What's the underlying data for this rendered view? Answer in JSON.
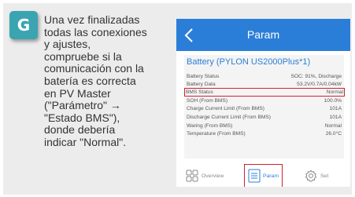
{
  "step": {
    "label": "G",
    "color": "#3aa4b1"
  },
  "instruction": "Una vez finalizadas\ntodas las conexiones\ny ajustes,\ncompruebe si la\ncomunicación con la\nbatería es correcta\nen PV Master\n(\"Parámetro\" →\n\"Estado BMS\"),\ndonde debería\nindicar \"Normal\".",
  "app": {
    "title": "Param",
    "header_color": "#2b7ed8",
    "panel_title": "Battery (PYLON US2000Plus*1)",
    "rows": [
      {
        "label": "Battery Status",
        "value": "SOC: 91%, Discharge"
      },
      {
        "label": "Battery Data",
        "value": "53.2V/0.7A/0.04kW"
      },
      {
        "label": "BMS Status",
        "value": "Normal"
      },
      {
        "label": "SOH (From BMS)",
        "value": "100.0%"
      },
      {
        "label": "Charge Current Limit (From BMS)",
        "value": "101A"
      },
      {
        "label": "Discharge Current Limit (From BMS)",
        "value": "101A"
      },
      {
        "label": "Waring (From BMS)",
        "value": "Normal"
      },
      {
        "label": "Temperature (From BMS)",
        "value": "26.0°C"
      }
    ],
    "highlight_color": "#d4202c",
    "tabs": [
      {
        "label": "Overview",
        "icon": "overview-icon"
      },
      {
        "label": "Param",
        "icon": "param-icon",
        "active": true
      },
      {
        "label": "Set",
        "icon": "gear-icon"
      }
    ]
  }
}
